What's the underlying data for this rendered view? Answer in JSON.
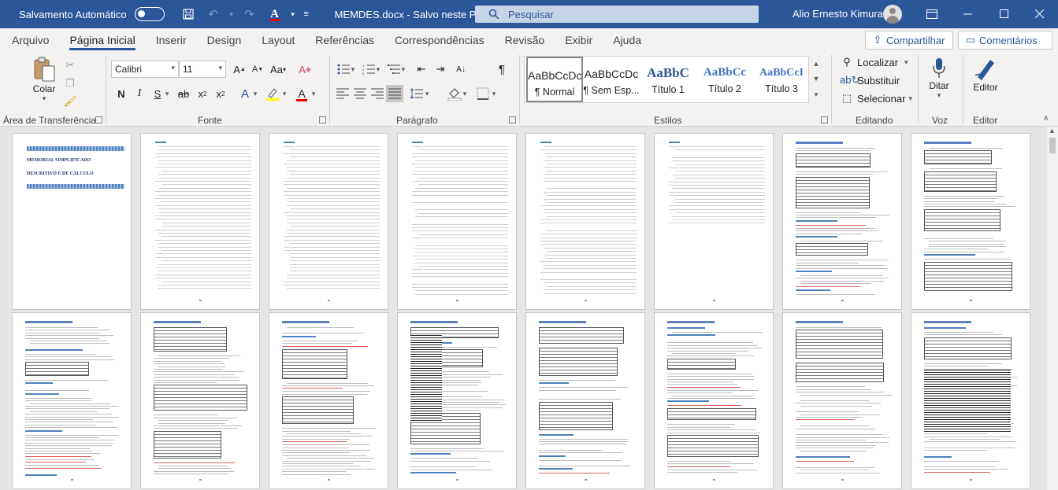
{
  "title_bar": {
    "autosave_label": "Salvamento Automático",
    "doc_title": "MEMDES.docx  -  Salvo neste PC",
    "search_placeholder": "Pesquisar",
    "user_name": "Alio Ernesto Kimura",
    "color": "#2b579a"
  },
  "ribbon_tabs": [
    "Arquivo",
    "Página Inicial",
    "Inserir",
    "Design",
    "Layout",
    "Referências",
    "Correspondências",
    "Revisão",
    "Exibir",
    "Ajuda"
  ],
  "active_tab": "Página Inicial",
  "share_label": "Compartilhar",
  "comments_label": "Comentários",
  "clipboard": {
    "paste_label": "Colar",
    "group_label": "Área de Transferência"
  },
  "font": {
    "font_name": "Calibri",
    "font_size": "11",
    "group_label": "Fonte"
  },
  "paragraph": {
    "group_label": "Parágrafo"
  },
  "styles": {
    "group_label": "Estilos",
    "items": [
      {
        "sample": "AaBbCcDc",
        "name": "¶ Normal"
      },
      {
        "sample": "AaBbCcDc",
        "name": "¶ Sem Esp..."
      },
      {
        "sample": "AaBbC",
        "name": "Título 1"
      },
      {
        "sample": "AaBbCc",
        "name": "Título 2"
      },
      {
        "sample": "AaBbCcI",
        "name": "Título 3"
      }
    ]
  },
  "editing": {
    "group_label": "Editando",
    "find_label": "Localizar",
    "replace_label": "Substituir",
    "select_label": "Selecionar"
  },
  "voice": {
    "dictate_label": "Ditar",
    "group_label": "Voz"
  },
  "editor": {
    "editor_label": "Editor",
    "group_label": "Editor"
  },
  "cover": {
    "line1": "MEMORIAL SIMPLIFICADO",
    "line2": "DESCRITIVO E DE CÁLCULO"
  }
}
